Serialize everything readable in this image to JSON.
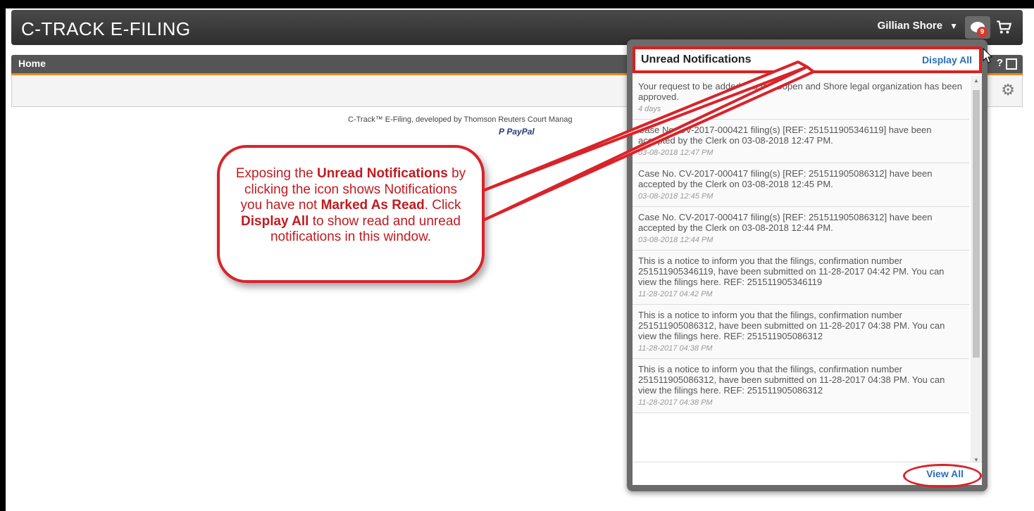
{
  "app": {
    "logo": "C-TRACK E-FILING"
  },
  "header": {
    "user_name": "Gillian Shore",
    "notifications_badge": "9"
  },
  "home": {
    "title": "Home",
    "help_label": "?"
  },
  "footer": {
    "text": "C-Track™ E-Filing, developed by Thomson Reuters Court Manag",
    "paypal": "PayPal"
  },
  "callout": {
    "part1": "Exposing the ",
    "bold1": "Unread Notifications",
    "part2": " by clicking the icon shows Notifications you have not ",
    "bold2": "Marked As Read",
    "part3": ".  Click ",
    "bold3": "Display All",
    "part4": " to show read and unread notifications in this window."
  },
  "panel": {
    "title": "Unread Notifications",
    "display_all": "Display All",
    "view_all": "View All",
    "items": [
      {
        "text": "Your request to be added into the Copen and Shore legal organization has been approved.",
        "time": "4 days"
      },
      {
        "text": "Case No. CV-2017-000421 filing(s) [REF: 251511905346119] have been accepted by the Clerk on 03-08-2018 12:47 PM.",
        "time": "03-08-2018 12:47 PM"
      },
      {
        "text": "Case No. CV-2017-000417 filing(s) [REF: 251511905086312] have been accepted by the Clerk on 03-08-2018 12:45 PM.",
        "time": "03-08-2018 12:45 PM"
      },
      {
        "text": "Case No. CV-2017-000417 filing(s) [REF: 251511905086312] have been accepted by the Clerk on 03-08-2018 12:44 PM.",
        "time": "03-08-2018 12:44 PM"
      },
      {
        "text": "This is a notice to inform you that the filings, confirmation number 251511905346119, have been submitted on 11-28-2017 04:42 PM. You can view the filings here. REF: 251511905346119",
        "time": "11-28-2017 04:42 PM"
      },
      {
        "text": "This is a notice to inform you that the filings, confirmation number 251511905086312, have been submitted on 11-28-2017 04:38 PM. You can view the filings here. REF: 251511905086312",
        "time": "11-28-2017 04:38 PM"
      },
      {
        "text": "This is a notice to inform you that the filings, confirmation number 251511905086312, have been submitted on 11-28-2017 04:38 PM. You can view the filings here. REF: 251511905086312",
        "time": "11-28-2017 04:38 PM"
      }
    ]
  },
  "colors": {
    "accent_red": "#d9232a",
    "link_blue": "#2a6ebb",
    "home_underline": "#e58e1a"
  }
}
